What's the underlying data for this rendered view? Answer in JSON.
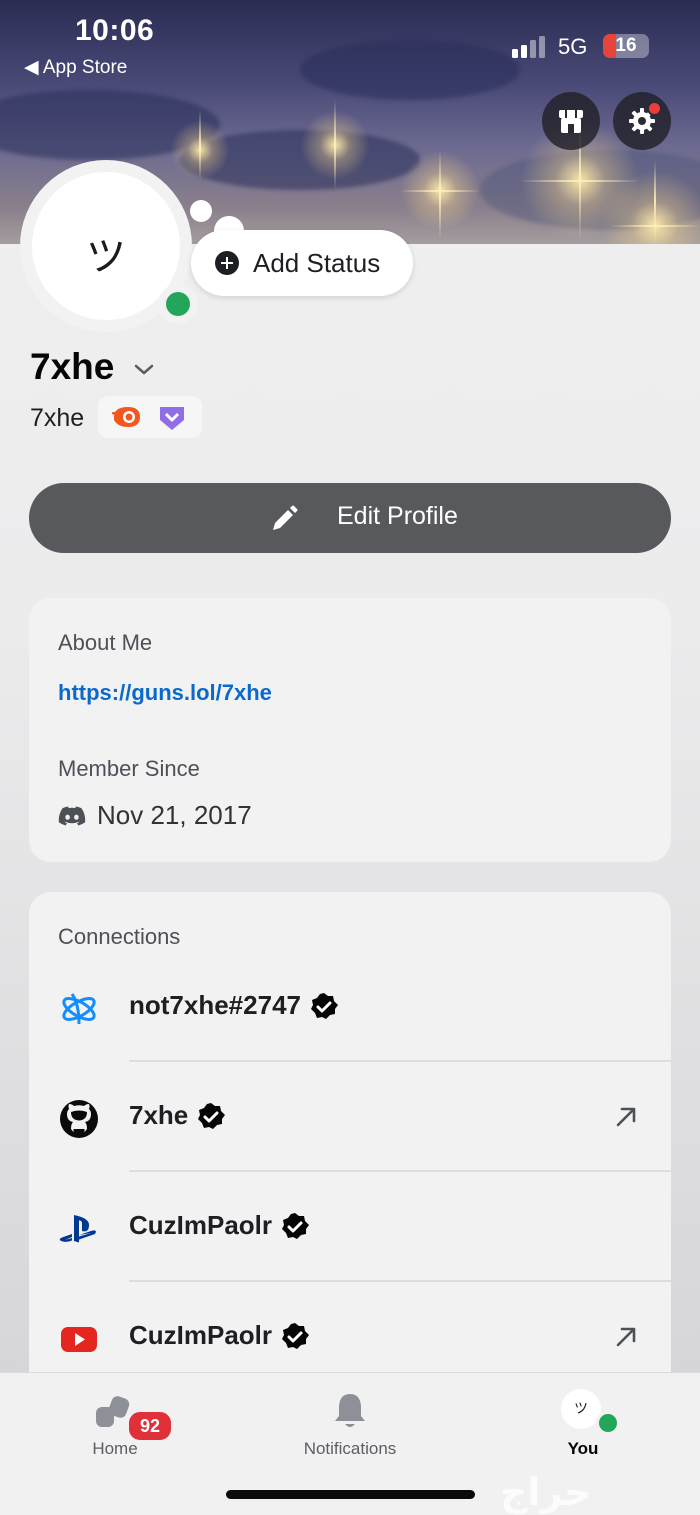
{
  "status_bar": {
    "time": "10:06",
    "back_app": "◀ App Store",
    "network": "5G",
    "battery": "16",
    "battery_level": 0.16
  },
  "header": {
    "shop_icon": "shop-icon",
    "settings_icon": "gear-icon",
    "settings_has_notification": true
  },
  "profile": {
    "avatar_text": "ツ",
    "status_color": "#23a55a",
    "add_status_label": "Add Status",
    "display_name": "7xhe",
    "username": "7xhe",
    "badges": [
      "orange-nitro-badge",
      "purple-hypesquad-badge"
    ]
  },
  "edit_profile": {
    "label": "Edit Profile"
  },
  "about": {
    "heading": "About Me",
    "link": "https://guns.lol/7xhe",
    "member_since_heading": "Member Since",
    "member_since_date": "Nov 21, 2017"
  },
  "connections": {
    "heading": "Connections",
    "items": [
      {
        "service": "battlenet",
        "name": "not7xhe#2747",
        "verified": true,
        "external": false
      },
      {
        "service": "github",
        "name": "7xhe",
        "verified": true,
        "external": true
      },
      {
        "service": "playstation",
        "name": "CuzImPaolr",
        "verified": true,
        "external": false
      },
      {
        "service": "youtube",
        "name": "CuzImPaolr",
        "verified": true,
        "external": true
      }
    ]
  },
  "tabbar": {
    "home_label": "Home",
    "home_badge": "92",
    "notifications_label": "Notifications",
    "you_label": "You",
    "you_avatar_text": "ツ"
  },
  "colors": {
    "accent_link": "#0a6acb",
    "online": "#23a55a",
    "badge_red": "#e0303a",
    "edit_button": "#58595d"
  },
  "watermark": "حراج"
}
